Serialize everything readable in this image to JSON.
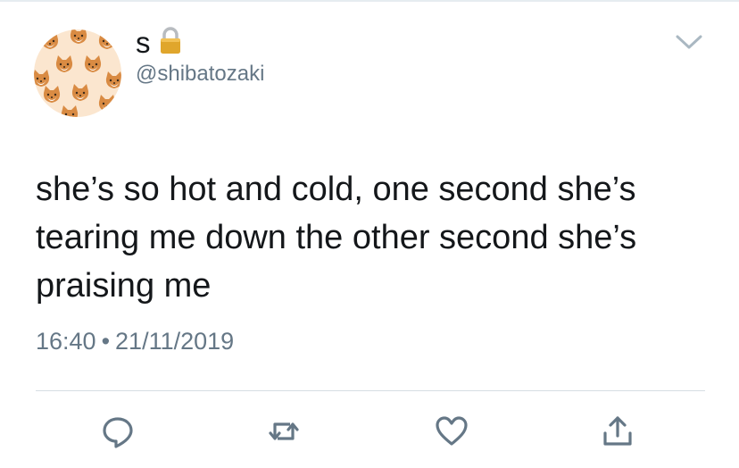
{
  "tweet": {
    "author": {
      "display_name": "s",
      "handle": "@shibatozaki",
      "avatar_icon": "shiba-pattern-avatar",
      "protected_icon": "lock-icon"
    },
    "text": "she’s so hot and cold, one second she’s tearing me down the other second she’s praising me",
    "time": "16:40",
    "separator": "•",
    "date": "21/11/2019"
  },
  "actions": [
    {
      "icon": "reply-icon"
    },
    {
      "icon": "retweet-icon"
    },
    {
      "icon": "like-icon"
    },
    {
      "icon": "share-icon"
    }
  ],
  "colors": {
    "text": "#14171a",
    "secondary": "#657786",
    "divider": "#d6dde3",
    "lock": "#e0a62c",
    "icon_gray": "#657786",
    "avatar_bg": "#fbe6cf"
  }
}
